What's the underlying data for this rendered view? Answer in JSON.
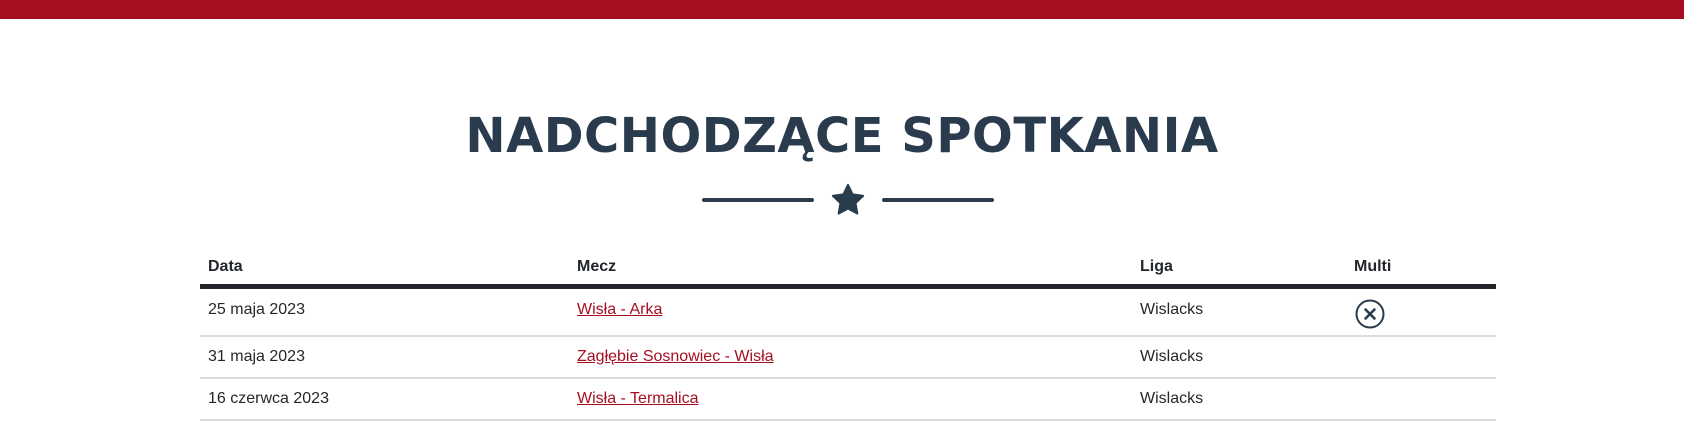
{
  "brand_color": "#a60f22",
  "heading_color": "#2b3b4e",
  "section": {
    "title": "NADCHODZĄCE SPOTKANIA",
    "divider_icon": "star-icon"
  },
  "table": {
    "headers": {
      "date": "Data",
      "match": "Mecz",
      "league": "Liga",
      "multi": "Multi"
    },
    "rows": [
      {
        "date": "25 maja 2023",
        "match": "Wisła - Arka",
        "league": "Wislacks",
        "multi_icon": "close-circle-icon"
      },
      {
        "date": "31 maja 2023",
        "match": "Zagłębie Sosnowiec - Wisła",
        "league": "Wislacks"
      },
      {
        "date": "16 czerwca 2023",
        "match": "Wisła - Termalica",
        "league": "Wislacks"
      }
    ]
  }
}
